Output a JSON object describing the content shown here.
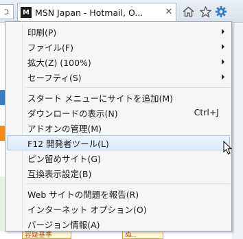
{
  "window": {
    "tab_title": "MSN Japan - Hotmail, O...",
    "tab_favicon_letter": "M",
    "address_fragment": "ↄ",
    "close_glyph": "✕"
  },
  "toolbar": {
    "icons": [
      "home-icon",
      "favorites-star-icon",
      "tools-gear-icon"
    ],
    "accent": "#3c7fc1"
  },
  "page_behind": {
    "bottom_box_1": "容疑基準",
    "bottom_box_2": "ぬ.."
  },
  "menu": {
    "items": [
      {
        "label": "印刷(P)",
        "submenu": true
      },
      {
        "label": "ファイル(F)",
        "submenu": true
      },
      {
        "label": "拡大(Z) (100%)",
        "submenu": true
      },
      {
        "label": "セーフティ(S)",
        "submenu": true
      },
      {
        "label": "スタート メニューにサイトを追加(M)"
      },
      {
        "label": "ダウンロードの表示(N)",
        "shortcut": "Ctrl+J"
      },
      {
        "label": "アドオンの管理(M)"
      },
      {
        "label": "F12 開発者ツール(L)",
        "highlighted": true
      },
      {
        "label": "ピン留めサイト(G)"
      },
      {
        "label": "互換表示設定(B)"
      },
      {
        "label": "Web サイトの問題を報告(R)"
      },
      {
        "label": "インターネット オプション(O)"
      },
      {
        "label": "バージョン情報(A)"
      }
    ]
  }
}
